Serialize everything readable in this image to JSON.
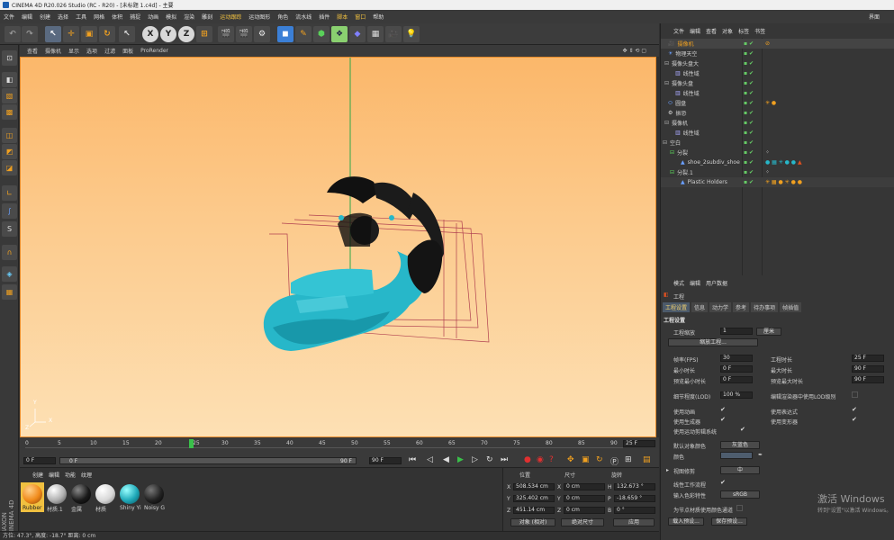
{
  "window": {
    "title": "CINEMA 4D R20.026 Studio (RC - R20) - [未标题 1.c4d] - 主要"
  },
  "menu": {
    "items": [
      "文件",
      "编辑",
      "创建",
      "选择",
      "工具",
      "网格",
      "体积",
      "运动跟踪",
      "运动图形",
      "角色",
      "流水线",
      "插件",
      "脚本",
      "窗口",
      "帮助"
    ],
    "extra": [
      "捕捉",
      "动画",
      "模拟",
      "渲染",
      "雕刻"
    ],
    "layout": "界面"
  },
  "viewport": {
    "menu": [
      "查看",
      "摄像机",
      "显示",
      "选项",
      "过滤",
      "面板",
      "ProRender"
    ],
    "axis": {
      "y": "Y",
      "x": "X",
      "z": "Z"
    }
  },
  "timeline": {
    "ticks": [
      "0",
      "5",
      "10",
      "15",
      "20",
      "25",
      "30",
      "35",
      "40",
      "45",
      "50",
      "55",
      "60",
      "65",
      "70",
      "75",
      "80",
      "85",
      "90"
    ],
    "end_frame": "25 F",
    "current": "0 F",
    "field_a": "0 F",
    "field_b": "90 F",
    "field_c": "90 F"
  },
  "materials": {
    "menu": [
      "创建",
      "编辑",
      "功能",
      "纹理"
    ],
    "items": [
      {
        "name": "Rubber",
        "color": "#f08a1a"
      },
      {
        "name": "材质.1",
        "color": "#b0b0b0"
      },
      {
        "name": "金属",
        "color": "#1a1a1a"
      },
      {
        "name": "材质",
        "color": "#d8d8d8"
      },
      {
        "name": "Shiny Yi",
        "color": "#1fa8b8"
      },
      {
        "name": "Noisy G",
        "color": "#222222"
      }
    ]
  },
  "coords": {
    "headers": [
      "位置",
      "尺寸",
      "旋转"
    ],
    "rows": [
      {
        "axis": "X",
        "pos": "508.534 cm",
        "size_axis": "X",
        "size": "0 cm",
        "rot_axis": "H",
        "rot": "132.673 °"
      },
      {
        "axis": "Y",
        "pos": "325.402 cm",
        "size_axis": "Y",
        "size": "0 cm",
        "rot_axis": "P",
        "rot": "-18.659 °"
      },
      {
        "axis": "Z",
        "pos": "451.14 cm",
        "size_axis": "Z",
        "size": "0 cm",
        "rot_axis": "B",
        "rot": "0 °"
      }
    ],
    "mode_a": "对象 (相对)",
    "mode_b": "绝对尺寸",
    "apply": "应用"
  },
  "objects": {
    "menu": [
      "文件",
      "编辑",
      "查看",
      "对象",
      "标签",
      "书签"
    ],
    "rows": [
      "摄像机",
      "物理天空",
      "摄像头盘大",
      "线性域",
      "摄像头盘",
      "线性域",
      "圆盘",
      "振恐",
      "摄像机",
      "线性域",
      "空白",
      "分裂",
      "shoe_2subdiv_shoe",
      "分裂.1",
      "Plastic Holders"
    ]
  },
  "attributes": {
    "menu": [
      "模式",
      "编辑",
      "用户数据"
    ],
    "title": "工程",
    "tabs": [
      "工程设置",
      "信息",
      "动力学",
      "参考",
      "待办事项",
      "帧插值"
    ],
    "section": "工程设置",
    "scale_label": "工程缩放",
    "scale_value": "1",
    "scale_unit": "厘米",
    "scale_btn": "缩放工程...",
    "fps_label": "帧率(FPS)",
    "fps": "30",
    "duration_label": "工程时长",
    "duration": "25 F",
    "min_label": "最小时长",
    "min": "0 F",
    "max_label": "最大时长",
    "max": "90 F",
    "pmin_label": "预览最小时长",
    "pmin": "0 F",
    "pmax_label": "预览最大时长",
    "pmax": "90 F",
    "lod_label": "细节程度(LOD)",
    "lod": "100 %",
    "lod_render": "编辑渲染器中使用LOD级别",
    "c1": "使用动画",
    "c2": "使用表达式",
    "c3": "使用生成器",
    "c4": "使用变形器",
    "c5": "使用运动剪辑系统",
    "default_color_label": "默认对象颜色",
    "default_color": "灰蓝色",
    "color_label": "颜色",
    "view_label": "视图修剪",
    "view_value": "中",
    "linear_label": "线性工作流程",
    "input_label": "输入色彩特性",
    "input_value": "sRGB",
    "node_label": "为节点材质使用颜色通道",
    "load_btn": "载入预设...",
    "save_btn": "保存预设..."
  },
  "status": {
    "text": "方位: 47.3°, 高度: -18.7° 距离: 0 cm"
  },
  "watermark": {
    "line1": "激活 Windows",
    "line2": "转到\"设置\"以激活 Windows。"
  }
}
